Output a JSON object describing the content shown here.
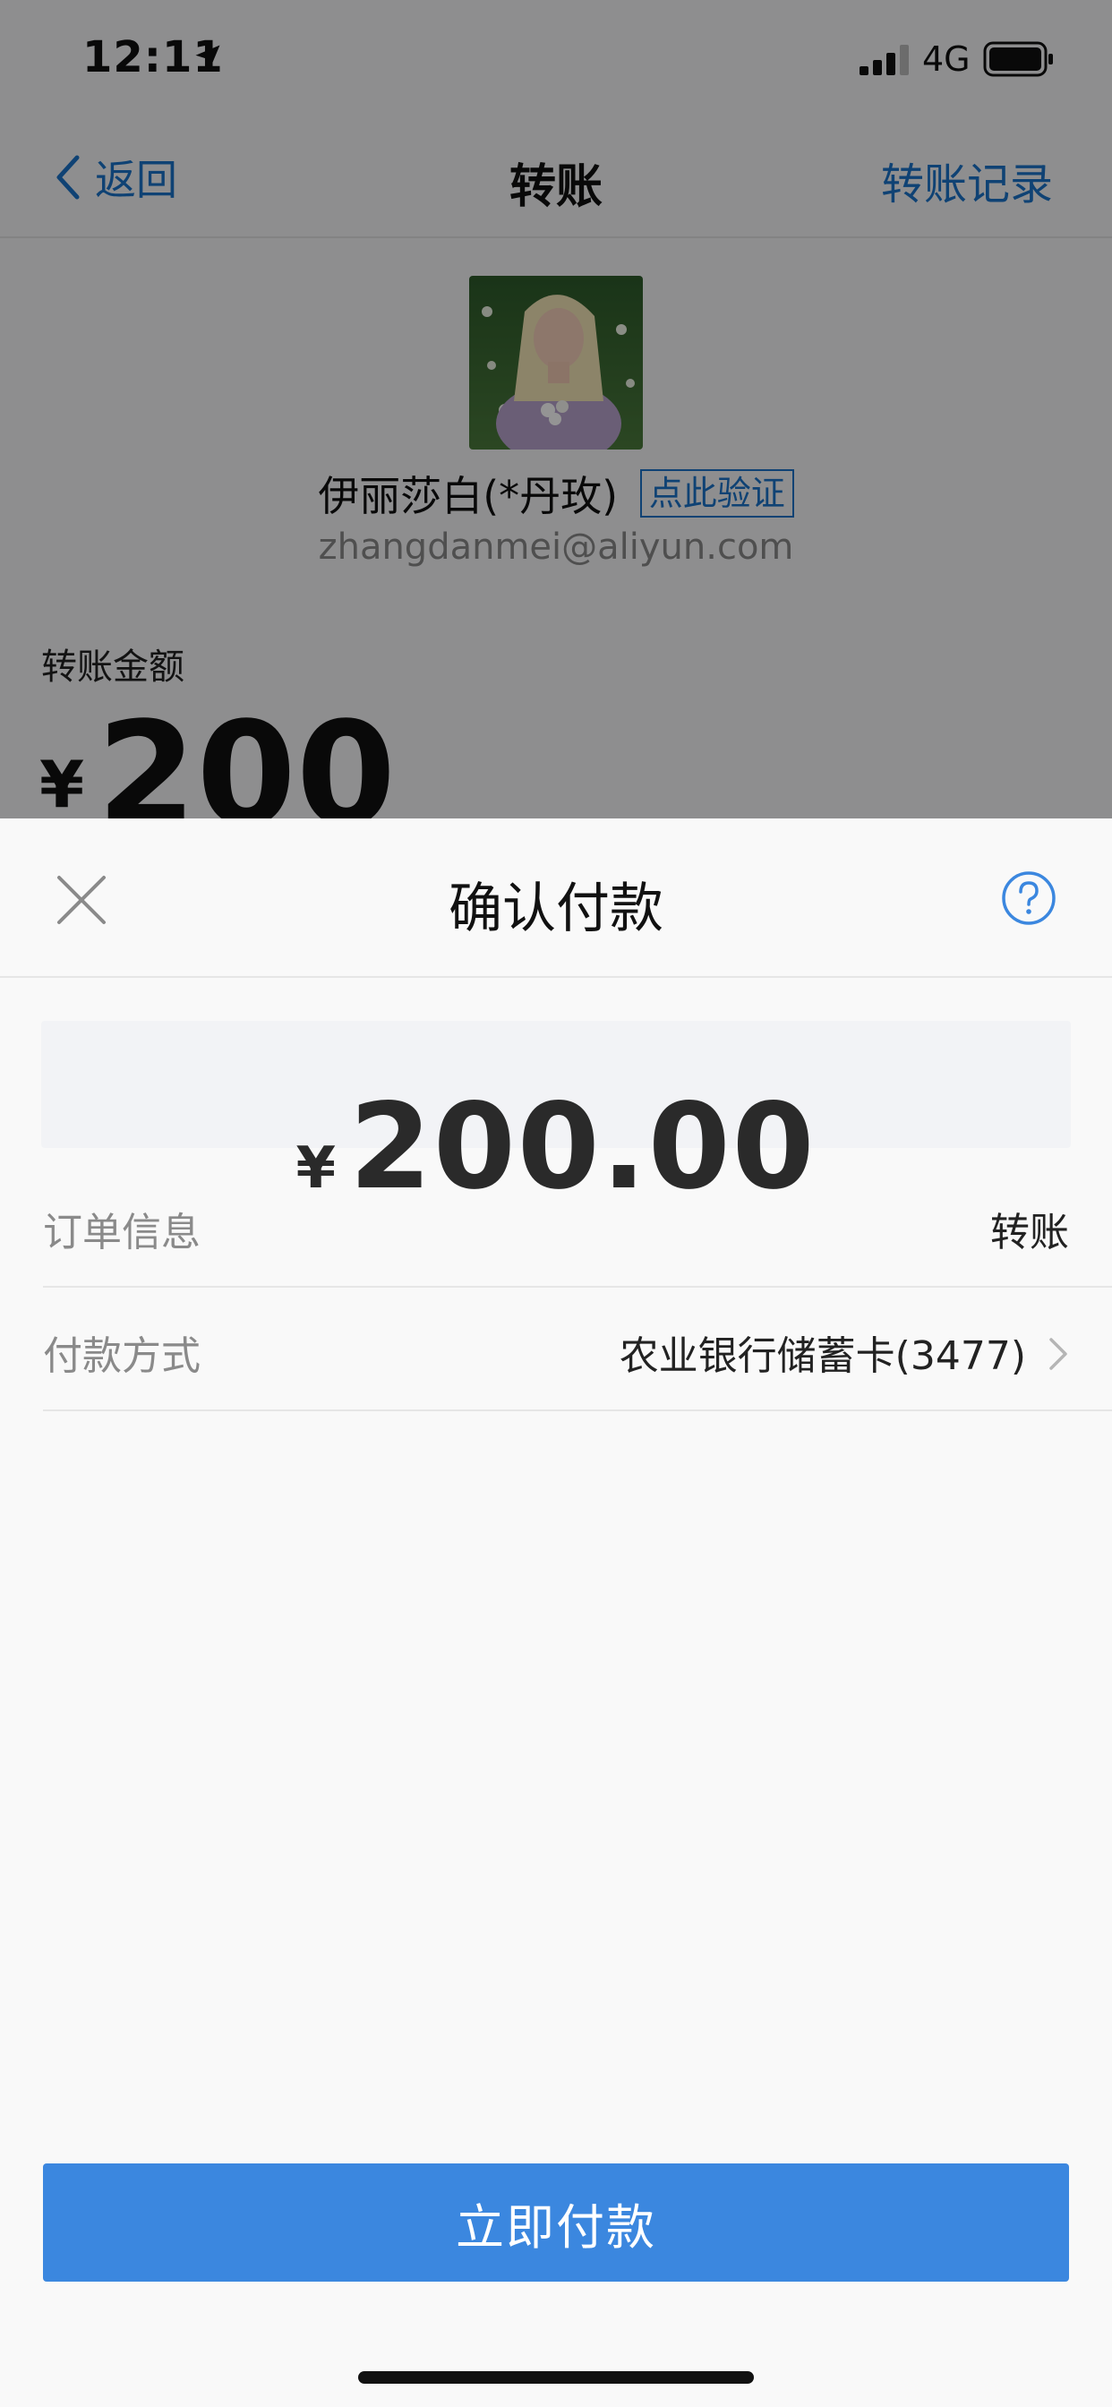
{
  "status_bar": {
    "time": "12:11",
    "network": "4G"
  },
  "nav": {
    "back_label": "返回",
    "title": "转账",
    "records_label": "转账记录"
  },
  "payee": {
    "name": "伊丽莎白(*丹玫)",
    "verify_label": "点此验证",
    "email": "zhangdanmei@aliyun.com"
  },
  "transfer": {
    "amount_label": "转账金额",
    "currency": "¥",
    "amount": "200"
  },
  "sheet": {
    "title": "确认付款",
    "currency": "¥",
    "amount": "200.00",
    "rows": [
      {
        "label": "订单信息",
        "value": "转账"
      },
      {
        "label": "付款方式",
        "value": "农业银行储蓄卡(3477)"
      }
    ],
    "pay_button_label": "立即付款"
  },
  "colors": {
    "accent": "#3b87df",
    "link": "#1a73c8",
    "overlay": "rgba(0,0,0,0.42)"
  },
  "icons": {
    "back": "chevron-left-icon",
    "close": "close-icon",
    "help": "question-circle-icon",
    "row_arrow": "chevron-right-icon",
    "location": "location-arrow-icon",
    "signal": "signal-icon",
    "battery": "battery-icon"
  }
}
